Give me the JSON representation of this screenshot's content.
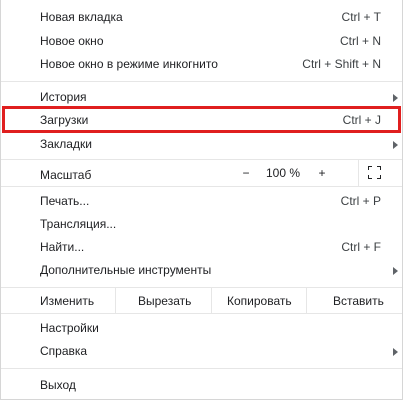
{
  "menu": {
    "new_tab": {
      "label": "Новая вкладка",
      "shortcut": "Ctrl + T"
    },
    "new_window": {
      "label": "Новое окно",
      "shortcut": "Ctrl + N"
    },
    "incognito": {
      "label": "Новое окно в режиме инкогнито",
      "shortcut": "Ctrl + Shift + N"
    },
    "history": {
      "label": "История"
    },
    "downloads": {
      "label": "Загрузки",
      "shortcut": "Ctrl + J"
    },
    "bookmarks": {
      "label": "Закладки"
    },
    "zoom": {
      "label": "Масштаб",
      "minus": "−",
      "value": "100 %",
      "plus": "+"
    },
    "print": {
      "label": "Печать...",
      "shortcut": "Ctrl + P"
    },
    "cast": {
      "label": "Трансляция..."
    },
    "find": {
      "label": "Найти...",
      "shortcut": "Ctrl + F"
    },
    "more_tools": {
      "label": "Дополнительные инструменты"
    },
    "edit": {
      "label": "Изменить",
      "cut": "Вырезать",
      "copy": "Копировать",
      "paste": "Вставить"
    },
    "settings": {
      "label": "Настройки"
    },
    "help": {
      "label": "Справка"
    },
    "exit": {
      "label": "Выход"
    }
  },
  "highlight_color": "#e01f1f",
  "icons": {
    "submenu": "chevron-right-icon",
    "fullscreen": "fullscreen-icon"
  }
}
